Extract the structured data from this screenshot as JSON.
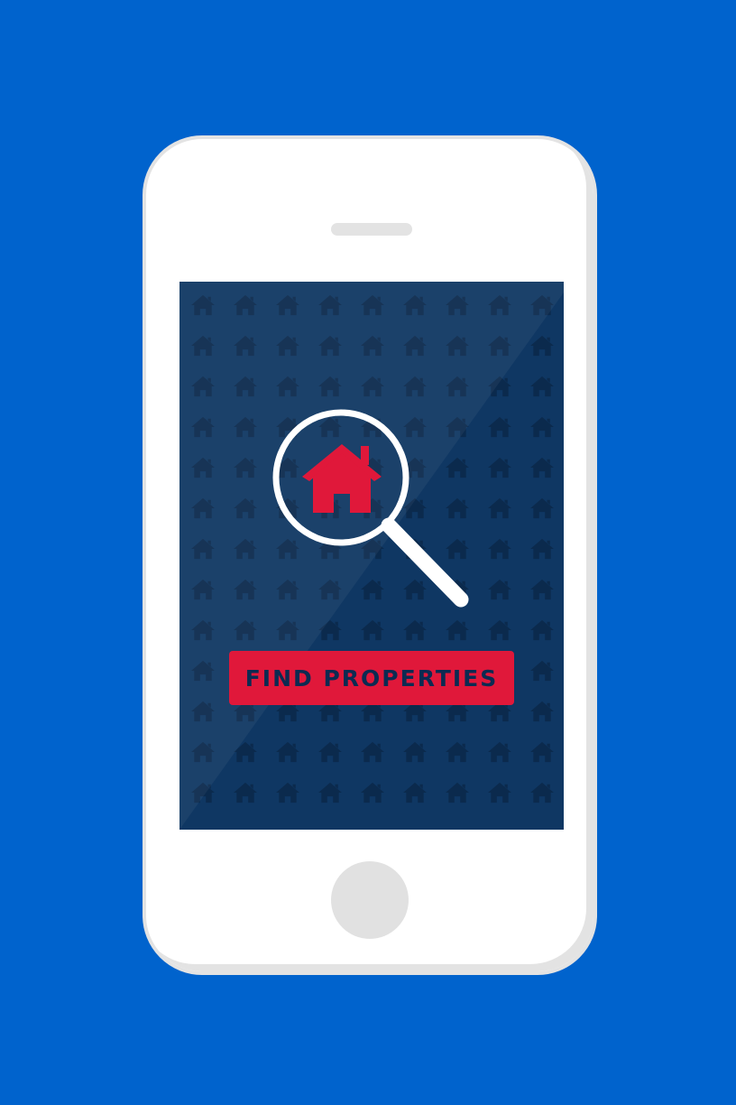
{
  "colors": {
    "background": "#0063cd",
    "phone_body": "#ffffff",
    "phone_bezel": "#e3e3e3",
    "screen": "#0f3763",
    "pattern_icon": "#0b2a4d",
    "accent_red": "#e0183a",
    "button_text": "#0c2b52",
    "magnifier": "#ffffff"
  },
  "screen": {
    "pattern_icon": "house-icon",
    "search_icon": "house-search-icon",
    "find_button_label": "FIND PROPERTIES"
  }
}
